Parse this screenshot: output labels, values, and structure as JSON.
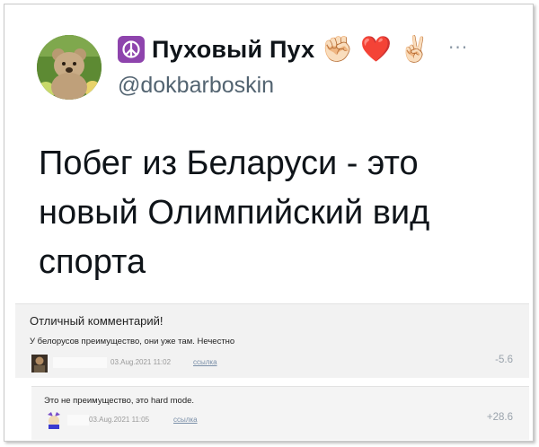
{
  "tweet": {
    "display_name": "Пуховый Пух",
    "handle": "@dokbarboskin",
    "name_emojis": [
      "✊🏻",
      "❤️",
      "✌🏻"
    ],
    "badge_icon": "peace-symbol-icon",
    "more_icon": "ellipsis-icon",
    "more_label": "···",
    "text": "Побег из Беларуси - это\nновый Олимпийский вид\nспорта"
  },
  "comments": [
    {
      "title": "Отличный комментарий!",
      "text": "У белорусов преимущество, они уже там. Нечестно",
      "date": "03.Aug.2021 11:02",
      "link": "ссылка",
      "score": "-5.6"
    },
    {
      "text": "Это не преимущество, это hard mode.",
      "date": "03.Aug.2021 11:05",
      "link": "ссылка",
      "score": "+28.6"
    }
  ],
  "colors": {
    "handle": "#536471",
    "badge": "#8e44ad",
    "comment_bg": "#f2f2f2",
    "link": "#7a8fa8"
  }
}
